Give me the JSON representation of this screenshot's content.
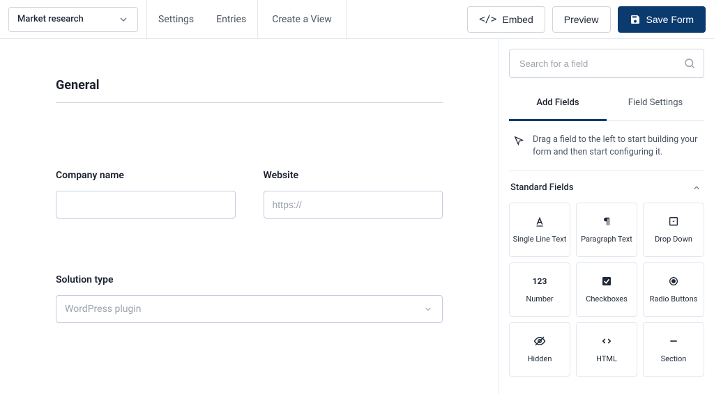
{
  "header": {
    "form_name": "Market research",
    "nav": {
      "settings": "Settings",
      "entries": "Entries",
      "create_view": "Create a View"
    },
    "buttons": {
      "embed": "Embed",
      "preview": "Preview",
      "save": "Save Form"
    }
  },
  "canvas": {
    "section_title": "General",
    "fields": {
      "company_name": {
        "label": "Company name",
        "value": ""
      },
      "website": {
        "label": "Website",
        "placeholder": "https://",
        "value": ""
      },
      "solution_type": {
        "label": "Solution type",
        "value": "WordPress plugin"
      }
    }
  },
  "sidepanel": {
    "search_placeholder": "Search for a field",
    "tabs": {
      "add_fields": "Add Fields",
      "field_settings": "Field Settings"
    },
    "hint": "Drag a field to the left to start building your form and then start configuring it.",
    "group_title": "Standard Fields",
    "field_types": {
      "single_line": "Single Line Text",
      "paragraph": "Paragraph Text",
      "dropdown": "Drop Down",
      "number": "Number",
      "checkboxes": "Checkboxes",
      "radio": "Radio Buttons",
      "hidden": "Hidden",
      "html": "HTML",
      "section": "Section"
    }
  }
}
